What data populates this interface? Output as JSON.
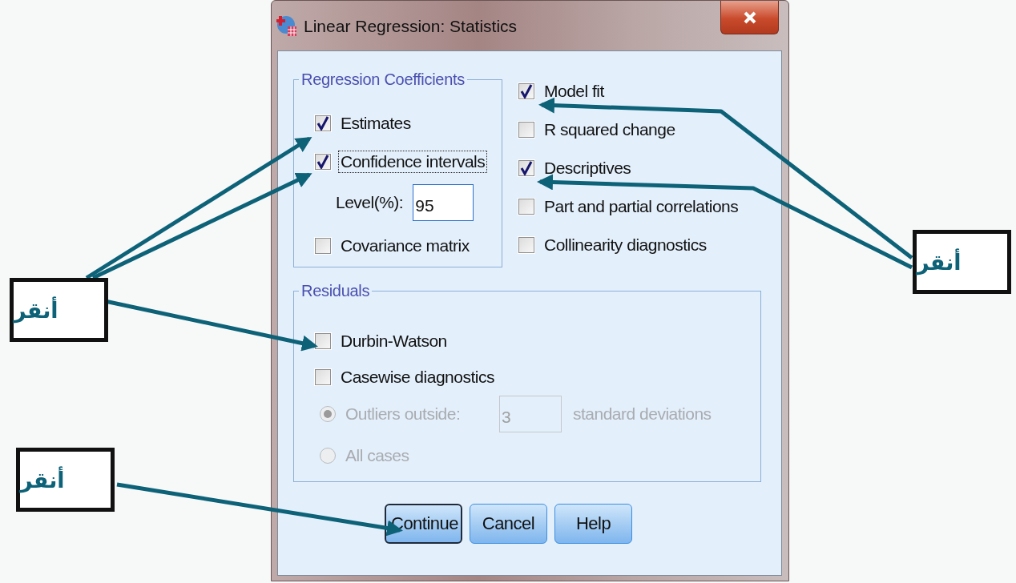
{
  "window": {
    "title": "Linear Regression: Statistics"
  },
  "regression_coefficients": {
    "title": "Regression Coefficients",
    "options": [
      {
        "label": "Estimates",
        "checked": true,
        "focused": false
      },
      {
        "label": "Confidence intervals",
        "checked": true,
        "focused": true
      }
    ],
    "level": {
      "label": "Level(%):",
      "value": "95"
    },
    "after": [
      {
        "label": "Covariance matrix",
        "checked": false,
        "focused": false
      }
    ]
  },
  "options": [
    {
      "label": "Model fit",
      "checked": true
    },
    {
      "label": "R squared change",
      "checked": false
    },
    {
      "label": "Descriptives",
      "checked": true
    },
    {
      "label": "Part and partial correlations",
      "checked": false
    },
    {
      "label": "Collinearity diagnostics",
      "checked": false
    }
  ],
  "residuals": {
    "title": "Residuals",
    "options": [
      {
        "label": "Durbin-Watson",
        "checked": false
      },
      {
        "label": "Casewise diagnostics",
        "checked": false
      }
    ],
    "radios": [
      {
        "label": "Outliers outside:",
        "selected": true,
        "disabled": true,
        "field": {
          "value": "3",
          "disabled": true
        },
        "suffix": "standard deviations"
      },
      {
        "label": "All cases",
        "selected": false,
        "disabled": true
      }
    ]
  },
  "buttons": [
    {
      "label": "Continue",
      "default": true
    },
    {
      "label": "Cancel",
      "default": false
    },
    {
      "label": "Help",
      "default": false
    }
  ],
  "callouts": [
    {
      "text": "أنقر"
    },
    {
      "text": "أنقر"
    },
    {
      "text": "أنقر"
    }
  ]
}
